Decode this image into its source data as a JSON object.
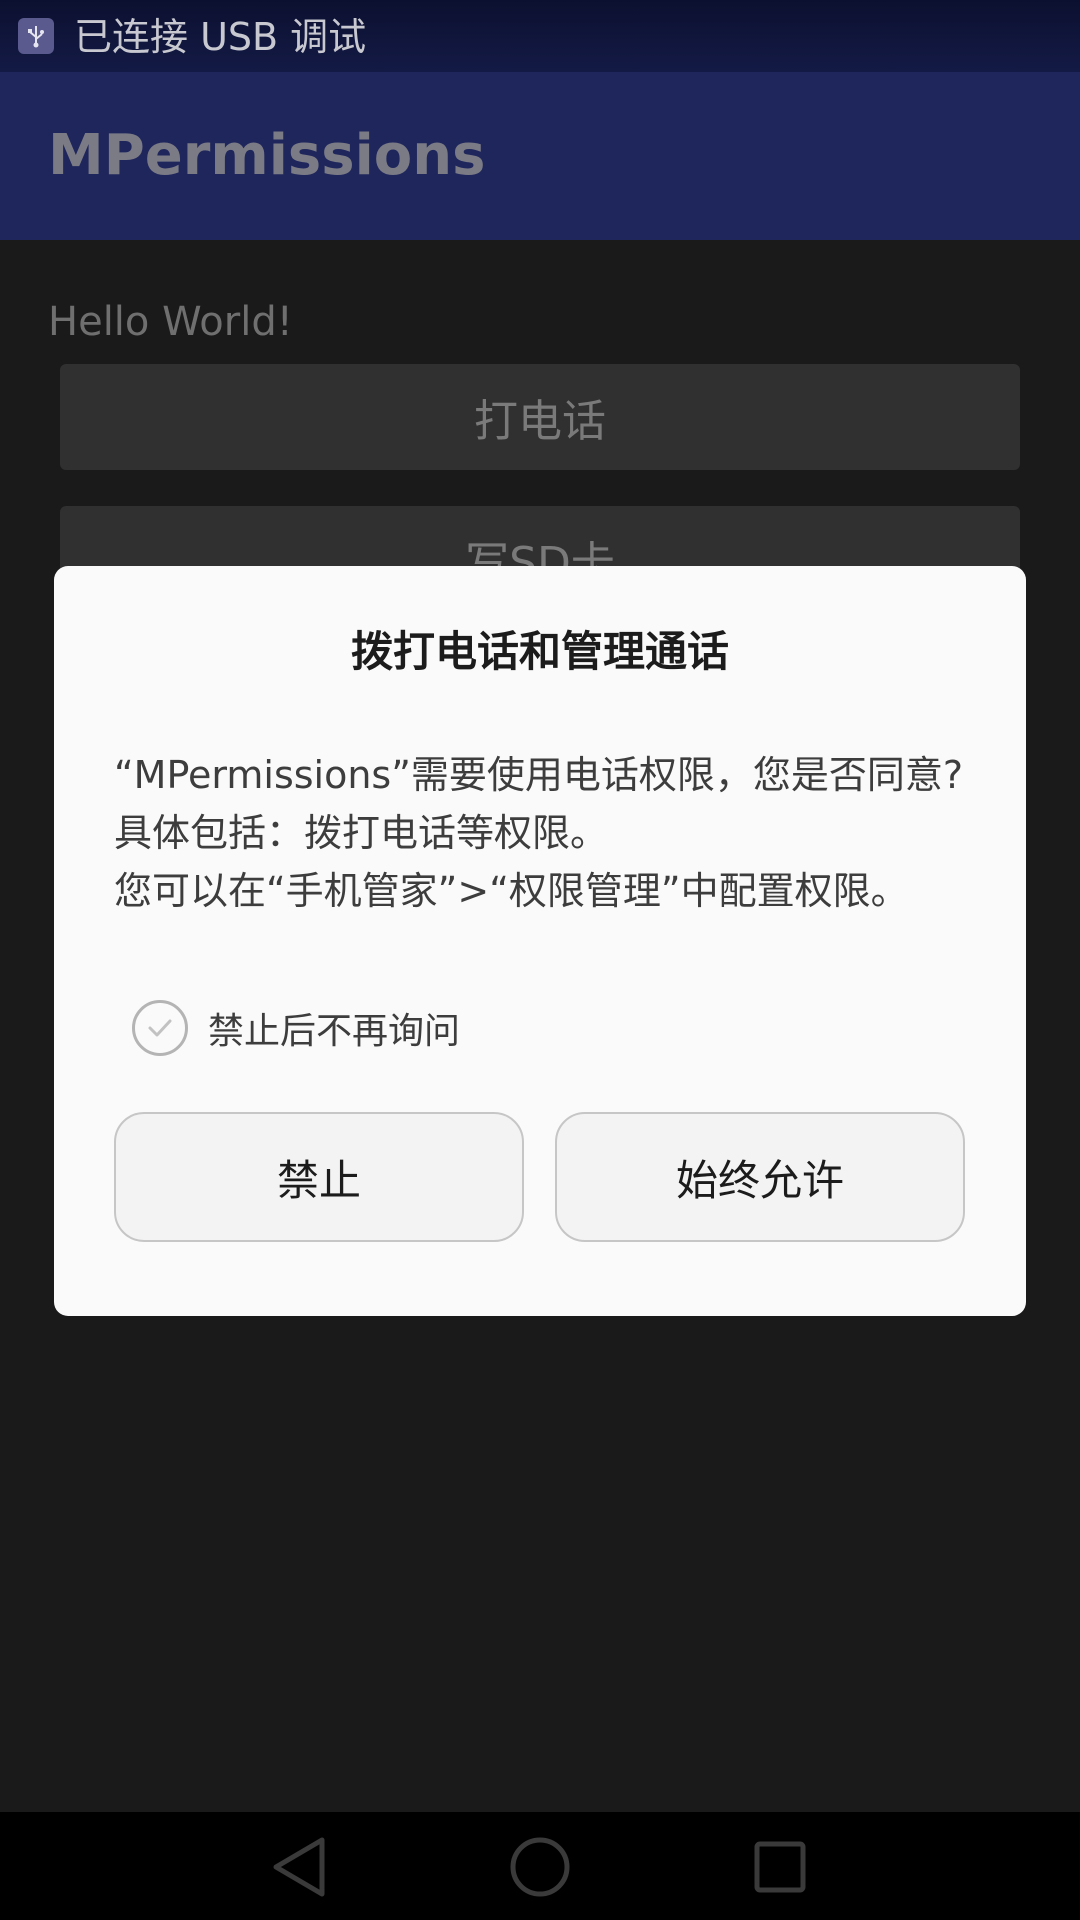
{
  "status_bar": {
    "text": "已连接 USB 调试",
    "icon": "usb-debug-icon"
  },
  "app_bar": {
    "title": "MPermissions"
  },
  "content": {
    "hello_text": "Hello World!",
    "call_button_label": "打电话",
    "sd_button_label": "写SD卡"
  },
  "dialog": {
    "title": "拨打电话和管理通话",
    "message_lines": [
      "“MPermissions”需要使用电话权限，您是否同意?",
      "具体包括：拨打电话等权限。",
      "您可以在“手机管家”>“权限管理”中配置权限。"
    ],
    "checkbox_label": "禁止后不再询问",
    "checkbox_checked": false,
    "deny_label": "禁止",
    "allow_label": "始终允许"
  },
  "nav_bar": {
    "icons": [
      "back-icon",
      "home-icon",
      "recent-apps-icon"
    ]
  },
  "colors": {
    "status_bar": "#131a45",
    "app_bar_dimmed": "#1f265b",
    "dialog_background": "#fafafa",
    "background_dimmed": "#1a1a1a"
  }
}
